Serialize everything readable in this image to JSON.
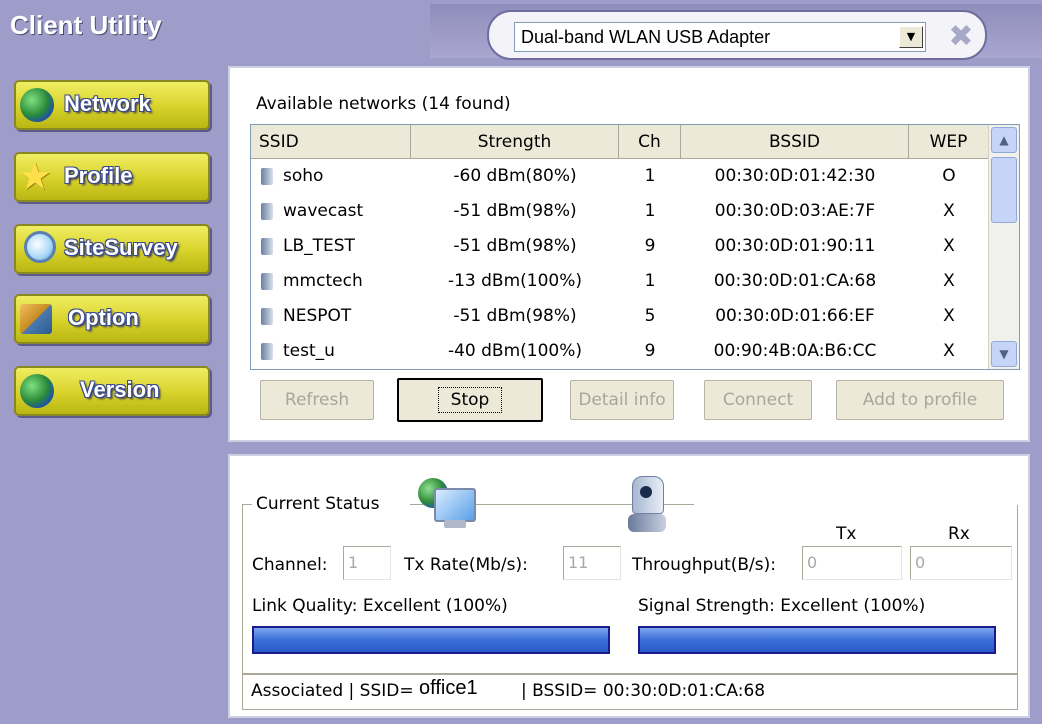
{
  "app": {
    "title": "Client Utility"
  },
  "adapter": {
    "selected": "Dual-band WLAN USB Adapter"
  },
  "nav": [
    {
      "label": "Network",
      "icon": "globe-icon"
    },
    {
      "label": "Profile",
      "icon": "star-icon"
    },
    {
      "label": "SiteSurvey",
      "icon": "magnifier-icon"
    },
    {
      "label": "Option",
      "icon": "settings-icon"
    },
    {
      "label": "Version",
      "icon": "globe-icon"
    }
  ],
  "networks": {
    "heading": "Available networks  (14 found)",
    "columns": [
      "SSID",
      "Strength",
      "Ch",
      "BSSID",
      "WEP"
    ],
    "rows": [
      [
        "soho",
        "-60 dBm(80%)",
        "1",
        "00:30:0D:01:42:30",
        "O"
      ],
      [
        "wavecast",
        "-51 dBm(98%)",
        "1",
        "00:30:0D:03:AE:7F",
        "X"
      ],
      [
        "LB_TEST",
        "-51 dBm(98%)",
        "9",
        "00:30:0D:01:90:11",
        "X"
      ],
      [
        "mmctech",
        "-13 dBm(100%)",
        "1",
        "00:30:0D:01:CA:68",
        "X"
      ],
      [
        "NESPOT",
        "-51 dBm(98%)",
        "5",
        "00:30:0D:01:66:EF",
        "X"
      ],
      [
        "test_u",
        "-40 dBm(100%)",
        "9",
        "00:90:4B:0A:B6:CC",
        "X"
      ]
    ],
    "buttons": {
      "refresh": "Refresh",
      "stop": "Stop",
      "detail": "Detail info",
      "connect": "Connect",
      "add": "Add to profile"
    }
  },
  "status": {
    "group_label": "Current Status",
    "channel_label": "Channel:",
    "channel_value": "1",
    "txrate_label": "Tx Rate(Mb/s):",
    "txrate_value": "11",
    "throughput_label": "Throughput(B/s):",
    "tx_header": "Tx",
    "rx_header": "Rx",
    "tx_value": "0",
    "rx_value": "0",
    "link_quality": "Link Quality:  Excellent (100%)",
    "link_quality_level": 1.0,
    "signal_strength": "Signal Strength:  Excellent (100%)",
    "signal_strength_level": 1.0,
    "assoc_prefix": "Associated | SSID=",
    "assoc_ssid": "office1",
    "assoc_bssid": "| BSSID= 00:30:0D:01:CA:68"
  },
  "colors": {
    "background": "#9e9cc8",
    "nav_button": "#d7d22a",
    "progress": "#3b6fd8"
  }
}
